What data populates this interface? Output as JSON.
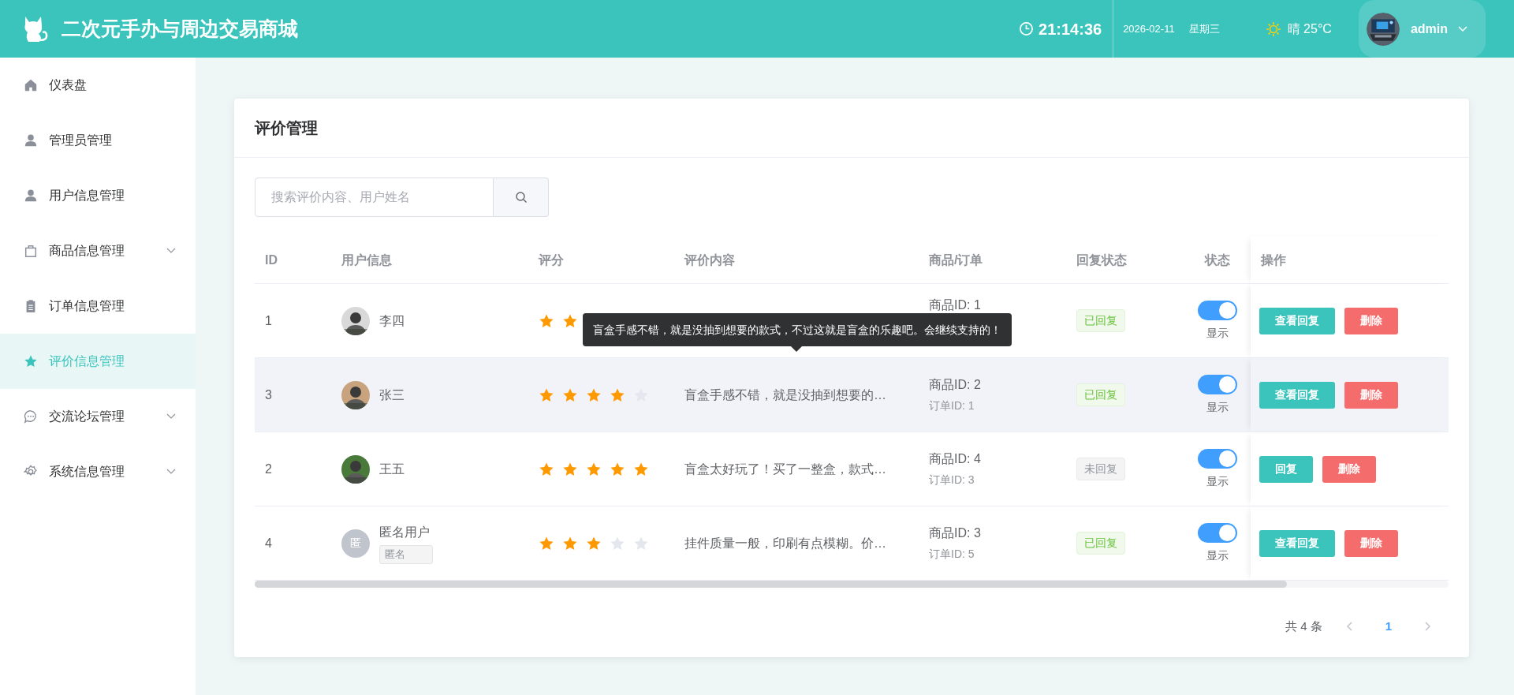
{
  "header": {
    "title": "二次元手办与周边交易商城",
    "time": "21:14:36",
    "date": "2026-02-11",
    "weekday": "星期三",
    "weather": "晴 25°C",
    "user": "admin"
  },
  "sidebar": {
    "items": [
      {
        "label": "仪表盘",
        "kind": "home",
        "selected": false,
        "expandable": false
      },
      {
        "label": "管理员管理",
        "kind": "person",
        "selected": false,
        "expandable": false
      },
      {
        "label": "用户信息管理",
        "kind": "person",
        "selected": false,
        "expandable": false
      },
      {
        "label": "商品信息管理",
        "kind": "bag",
        "selected": false,
        "expandable": true
      },
      {
        "label": "订单信息管理",
        "kind": "clipboard",
        "selected": false,
        "expandable": false
      },
      {
        "label": "评价信息管理",
        "kind": "star",
        "selected": true,
        "expandable": false
      },
      {
        "label": "交流论坛管理",
        "kind": "chat",
        "selected": false,
        "expandable": true
      },
      {
        "label": "系统信息管理",
        "kind": "gear",
        "selected": false,
        "expandable": true
      }
    ]
  },
  "page": {
    "title": "评价管理",
    "search": {
      "placeholder": "搜索评价内容、用户姓名"
    }
  },
  "table": {
    "columns": [
      "ID",
      "用户信息",
      "评分",
      "评价内容",
      "商品/订单",
      "回复状态",
      "状态",
      "操作"
    ],
    "rows": [
      {
        "id": "1",
        "user": "李四",
        "star_marks": [
          {
            "kind": "filled"
          },
          {
            "kind": "filled"
          }
        ],
        "product": "商品ID: 1",
        "reply": {
          "label": "已回复",
          "replied": true
        },
        "visible": true,
        "status_label": "显示",
        "actions": [
          {
            "label": "查看回复",
            "kind": "primary"
          },
          {
            "label": "删除",
            "kind": "danger"
          }
        ],
        "selected": false
      },
      {
        "id": "3",
        "user": "张三",
        "stars": 4,
        "content": "盲盒手感不错，就是没抽到想要的…",
        "product": "商品ID: 2",
        "order": "订单ID: 1",
        "reply": {
          "label": "已回复",
          "replied": true
        },
        "visible": true,
        "status_label": "显示",
        "actions": [
          {
            "label": "查看回复",
            "kind": "primary"
          },
          {
            "label": "删除",
            "kind": "danger"
          }
        ],
        "selected": true
      },
      {
        "id": "2",
        "user": "王五",
        "stars": 5,
        "content": "盲盒太好玩了！买了一整盒，款式…",
        "product": "商品ID: 4",
        "order": "订单ID: 3",
        "reply": {
          "label": "未回复",
          "replied": false
        },
        "visible": true,
        "status_label": "显示",
        "actions": [
          {
            "label": "回复",
            "kind": "primary"
          },
          {
            "label": "删除",
            "kind": "danger"
          }
        ],
        "selected": false
      },
      {
        "id": "4",
        "user": "匿名用户",
        "avatar": {
          "kind": "initial",
          "text": "匿"
        },
        "tag": "匿名",
        "stars": 3,
        "content": "挂件质量一般，印刷有点模糊。价…",
        "product": "商品ID: 3",
        "order": "订单ID: 5",
        "reply": {
          "label": "已回复",
          "replied": true
        },
        "visible": true,
        "status_label": "显示",
        "actions": [
          {
            "label": "查看回复",
            "kind": "primary"
          },
          {
            "label": "删除",
            "kind": "danger"
          }
        ],
        "selected": false
      }
    ]
  },
  "tooltip": {
    "text": "盲盒手感不错，就是没抽到想要的款式，不过这就是盲盒的乐趣吧。会继续支持的！"
  },
  "pagination": {
    "total": "共 4 条",
    "pages": [
      {
        "label": "1",
        "selected": true
      }
    ]
  }
}
